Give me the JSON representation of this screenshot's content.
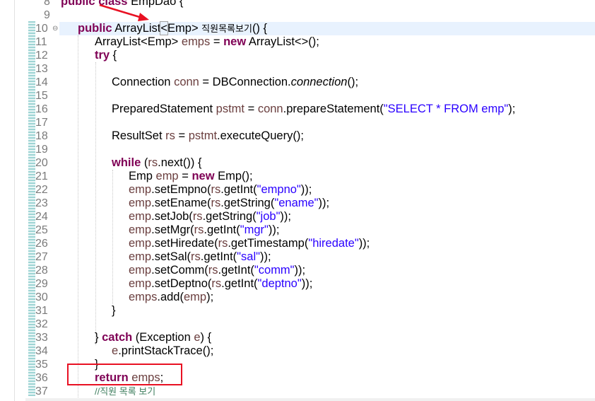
{
  "editor": {
    "lines": [
      {
        "n": "8",
        "text": "public class EmpDao {"
      },
      {
        "n": "9",
        "text": ""
      },
      {
        "n": "10",
        "text": "public ArrayList<Emp> 직원목록보기() {"
      },
      {
        "n": "11",
        "text": "ArrayList<Emp> emps = new ArrayList<>();"
      },
      {
        "n": "12",
        "text": "try {"
      },
      {
        "n": "13",
        "text": ""
      },
      {
        "n": "14",
        "text": "Connection conn = DBConnection.connection();"
      },
      {
        "n": "15",
        "text": ""
      },
      {
        "n": "16",
        "text": "PreparedStatement pstmt = conn.prepareStatement(\"SELECT * FROM emp\");"
      },
      {
        "n": "17",
        "text": ""
      },
      {
        "n": "18",
        "text": "ResultSet rs = pstmt.executeQuery();"
      },
      {
        "n": "19",
        "text": ""
      },
      {
        "n": "20",
        "text": "while (rs.next()) {"
      },
      {
        "n": "21",
        "text": "Emp emp = new Emp();"
      },
      {
        "n": "22",
        "text": "emp.setEmpno(rs.getInt(\"empno\"));"
      },
      {
        "n": "23",
        "text": "emp.setEname(rs.getString(\"ename\"));"
      },
      {
        "n": "24",
        "text": "emp.setJob(rs.getString(\"job\"));"
      },
      {
        "n": "25",
        "text": "emp.setMgr(rs.getInt(\"mgr\"));"
      },
      {
        "n": "26",
        "text": "emp.setHiredate(rs.getTimestamp(\"hiredate\"));"
      },
      {
        "n": "27",
        "text": "emp.setSal(rs.getInt(\"sal\"));"
      },
      {
        "n": "28",
        "text": "emp.setComm(rs.getInt(\"comm\"));"
      },
      {
        "n": "29",
        "text": "emp.setDeptno(rs.getInt(\"deptno\"));"
      },
      {
        "n": "30",
        "text": "emps.add(emp);"
      },
      {
        "n": "31",
        "text": "}"
      },
      {
        "n": "32",
        "text": ""
      },
      {
        "n": "33",
        "text": "} catch (Exception e) {"
      },
      {
        "n": "34",
        "text": "e.printStackTrace();"
      },
      {
        "n": "35",
        "text": "}"
      },
      {
        "n": "36",
        "text": "return emps;"
      },
      {
        "n": "37",
        "text": "//직원 목록 보기"
      }
    ],
    "fold_marker": "⊖",
    "colors": {
      "keyword": "#7f0055",
      "string": "#2a00ff",
      "variable": "#6a3e3e",
      "comment": "#3f7f5f",
      "current_line": "#e8f2fe",
      "annotation_red": "#e81123"
    }
  }
}
